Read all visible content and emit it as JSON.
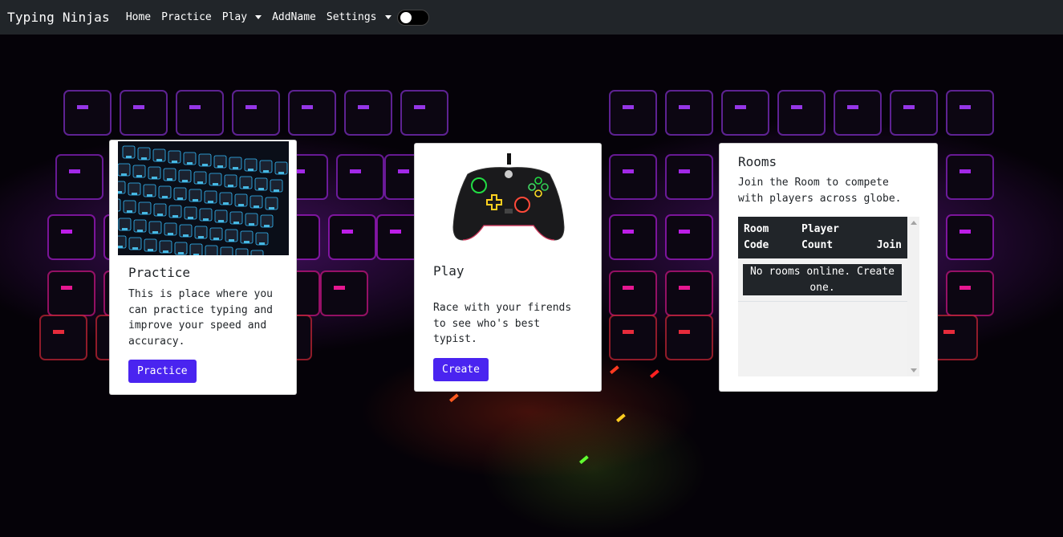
{
  "navbar": {
    "brand": "Typing Ninjas",
    "links": [
      {
        "label": "Home",
        "dropdown": false
      },
      {
        "label": "Practice",
        "dropdown": false
      },
      {
        "label": "Play",
        "dropdown": true
      },
      {
        "label": "AddName",
        "dropdown": false
      },
      {
        "label": "Settings",
        "dropdown": true
      }
    ],
    "theme_toggle": {
      "on": false
    }
  },
  "cards": {
    "practice": {
      "title": "Practice",
      "text": "This is place where you can practice typing and improve your speed and accuracy.",
      "button": "Practice",
      "image_icon": "keyboard-image"
    },
    "play": {
      "title": "Play",
      "text": "Race with your firends to see who's best typist.",
      "button": "Create",
      "image_icon": "gamepad-image"
    },
    "rooms": {
      "title": "Rooms",
      "text": "Join the Room to compete with players across globe.",
      "table": {
        "headers": [
          "Room Code",
          "Player Count",
          "Join"
        ],
        "empty_message": "No rooms online. Create one."
      }
    }
  },
  "colors": {
    "navbar_bg": "#212529",
    "button_primary": "#4a24f0",
    "neon_purple": "#b428ff"
  }
}
